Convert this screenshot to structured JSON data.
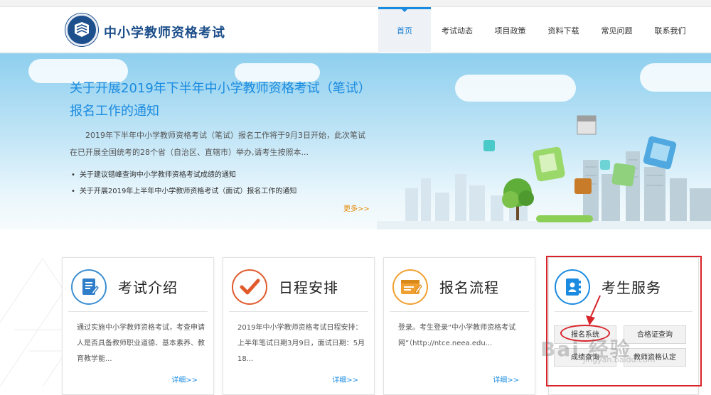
{
  "top_strip": {
    "text": ""
  },
  "header": {
    "site_title": "中小学教师资格考试",
    "nav": [
      {
        "label": "首页",
        "active": true
      },
      {
        "label": "考试动态"
      },
      {
        "label": "项目政策"
      },
      {
        "label": "资料下载"
      },
      {
        "label": "常见问题"
      },
      {
        "label": "联系我们"
      }
    ]
  },
  "banner": {
    "title": "关于开展2019年下半年中小学教师资格考试（笔试）报名工作的通知",
    "summary": "2019年下半年中小学教师资格考试（笔试）报名工作将于9月3日开始，此次笔试在已开展全国统考的28个省（自治区、直辖市）举办,请考生按照本...",
    "links": [
      "关于建议错峰查询中小学教师资格考试成绩的通知",
      "关于开展2019年上半年中小学教师资格考试（面试）报名工作的通知"
    ],
    "more": "更多>>"
  },
  "cards": [
    {
      "title": "考试介绍",
      "icon": "document-icon",
      "body": "通过实施中小学教师资格考试，考查申请人是否具备教师职业道德、基本素养、教育教学能...",
      "more": "详细>>"
    },
    {
      "title": "日程安排",
      "icon": "check-icon",
      "body": "2019年中小学教师资格考试日程安排：上半年笔试日期3月9日，面试日期：5月18...",
      "more": "详细>>"
    },
    {
      "title": "报名流程",
      "icon": "form-icon",
      "body": "登录。考生登录“中小学教师资格考试网”（http://ntce.neea.edu...",
      "more": "详细>>"
    },
    {
      "title": "考生服务",
      "icon": "address-book-icon"
    }
  ],
  "services": {
    "register": "报名系统",
    "admission_ticket": "合格证查询",
    "score_query": "成绩查询",
    "certificate": "教师资格认定"
  },
  "watermark": {
    "brand": "Bai 经验",
    "url": "jingyan.baidu.com"
  },
  "colors": {
    "brand": "#1c4f8a",
    "accent": "#1a8be0",
    "highlight": "#d8232a",
    "more": "#e68a00"
  }
}
